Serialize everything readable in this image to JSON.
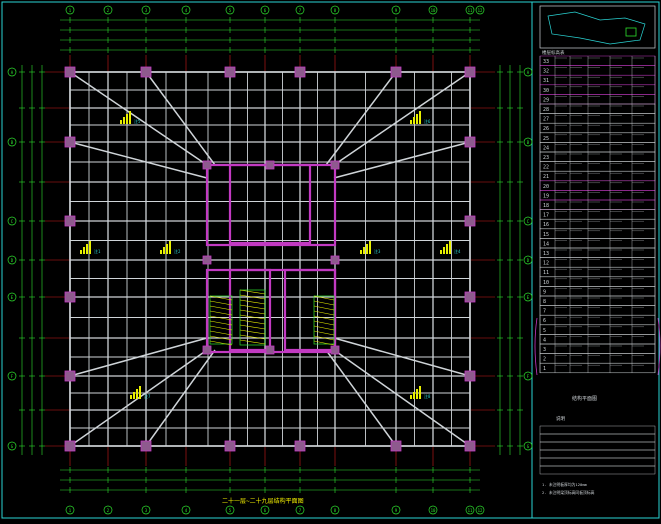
{
  "drawing": {
    "title": "二十一层~二十九层结构平面图",
    "colors": {
      "background": "#000000",
      "frame": "#2ad4d4",
      "grid_line": "#d11c1c",
      "beam": "#cfd4d8",
      "core_wall": "#c23ac2",
      "column": "#8e5a8e",
      "dim_line": "#2ee22e",
      "annotation": "#e8f000",
      "table": "#cfd4d8"
    },
    "axes_top": [
      "1",
      "2",
      "3",
      "4",
      "5",
      "6",
      "7",
      "8",
      "9",
      "10",
      "11",
      "12"
    ],
    "axes_left": [
      "A",
      "B",
      "C",
      "D",
      "E",
      "F",
      "G"
    ],
    "annotations": [
      {
        "text": "注1"
      },
      {
        "text": "注2"
      },
      {
        "text": "注3"
      },
      {
        "text": "注4"
      },
      {
        "text": "注5"
      },
      {
        "text": "注6"
      },
      {
        "text": "注7"
      },
      {
        "text": "注8"
      }
    ]
  },
  "side_panel": {
    "table_title": "楼层标高表",
    "drawing_name": "结构平面图",
    "floor_rows": [
      "33",
      "32",
      "31",
      "30",
      "29",
      "28",
      "27",
      "26",
      "25",
      "24",
      "23",
      "22",
      "21",
      "20",
      "19",
      "18",
      "17",
      "16",
      "15",
      "14",
      "13",
      "12",
      "11",
      "10",
      "9",
      "8",
      "7",
      "6",
      "5",
      "4",
      "3",
      "2",
      "1"
    ],
    "notes_title": "说明",
    "notes": [
      "1. 未注明板厚均为120mm",
      "2. 未注明梁顶标高同板顶标高"
    ]
  }
}
